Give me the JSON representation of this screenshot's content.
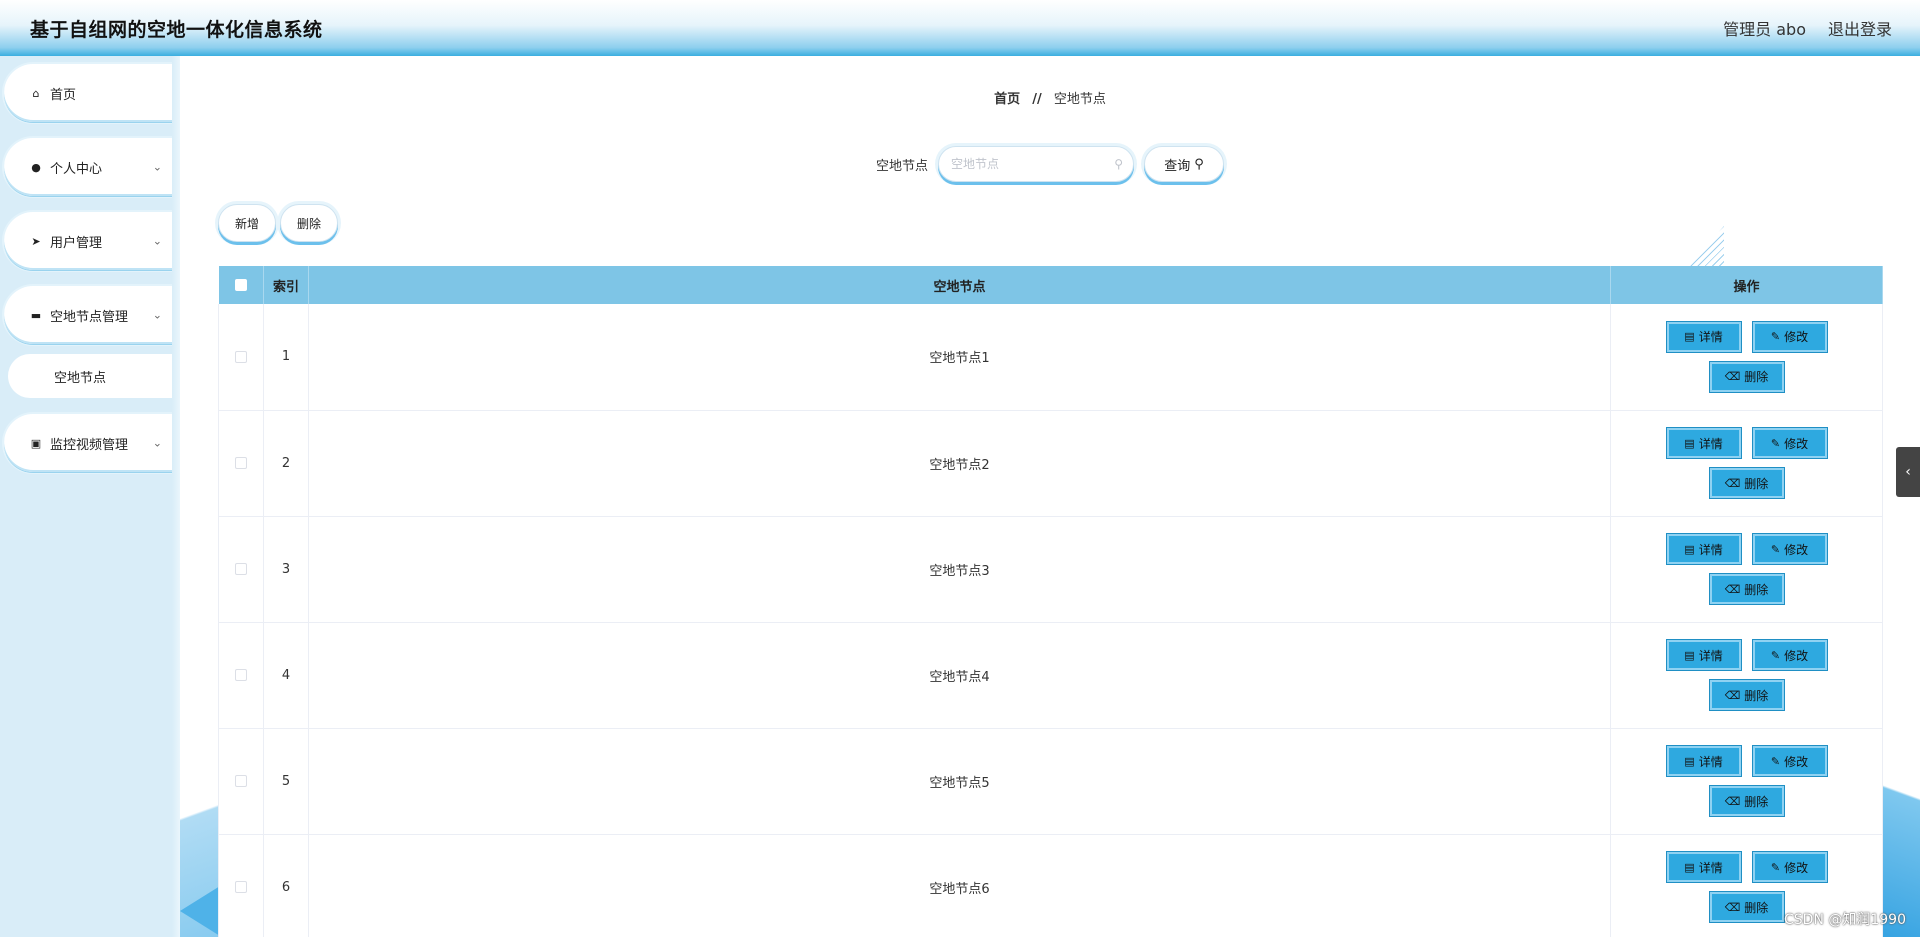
{
  "header": {
    "title": "基于自组网的空地一体化信息系统",
    "user_label": "管理员 abo",
    "logout_label": "退出登录"
  },
  "sidebar": {
    "items": [
      {
        "label": "首页",
        "icon": "home-icon",
        "glyph": "⌂",
        "expandable": false
      },
      {
        "label": "个人中心",
        "icon": "user-icon",
        "glyph": "👤",
        "expandable": true
      },
      {
        "label": "用户管理",
        "icon": "send-icon",
        "glyph": "➤",
        "expandable": true
      },
      {
        "label": "空地节点管理",
        "icon": "briefcase-icon",
        "glyph": "▰",
        "expandable": true
      },
      {
        "label": "监控视频管理",
        "icon": "clipboard-icon",
        "glyph": "▣",
        "expandable": true
      }
    ],
    "sub_item": {
      "label": "空地节点"
    }
  },
  "breadcrumb": {
    "home": "首页",
    "separator": "//",
    "current": "空地节点"
  },
  "search": {
    "label": "空地节点",
    "placeholder": "空地节点",
    "value": "",
    "query_label": "查询"
  },
  "actions": {
    "add_label": "新增",
    "delete_label": "删除"
  },
  "table": {
    "headers": {
      "index": "索引",
      "name": "空地节点",
      "ops": "操作"
    },
    "rows": [
      {
        "index": "1",
        "name": "空地节点1"
      },
      {
        "index": "2",
        "name": "空地节点2"
      },
      {
        "index": "3",
        "name": "空地节点3"
      },
      {
        "index": "4",
        "name": "空地节点4"
      },
      {
        "index": "5",
        "name": "空地节点5"
      },
      {
        "index": "6",
        "name": "空地节点6"
      }
    ],
    "op_labels": {
      "detail": "详情",
      "edit": "修改",
      "delete": "删除"
    }
  },
  "colors": {
    "accent": "#2ea9e0",
    "header_bg": "#7ec5e6",
    "sidebar_bg": "#d9edf8"
  },
  "watermark": "CSDN @知润1990"
}
